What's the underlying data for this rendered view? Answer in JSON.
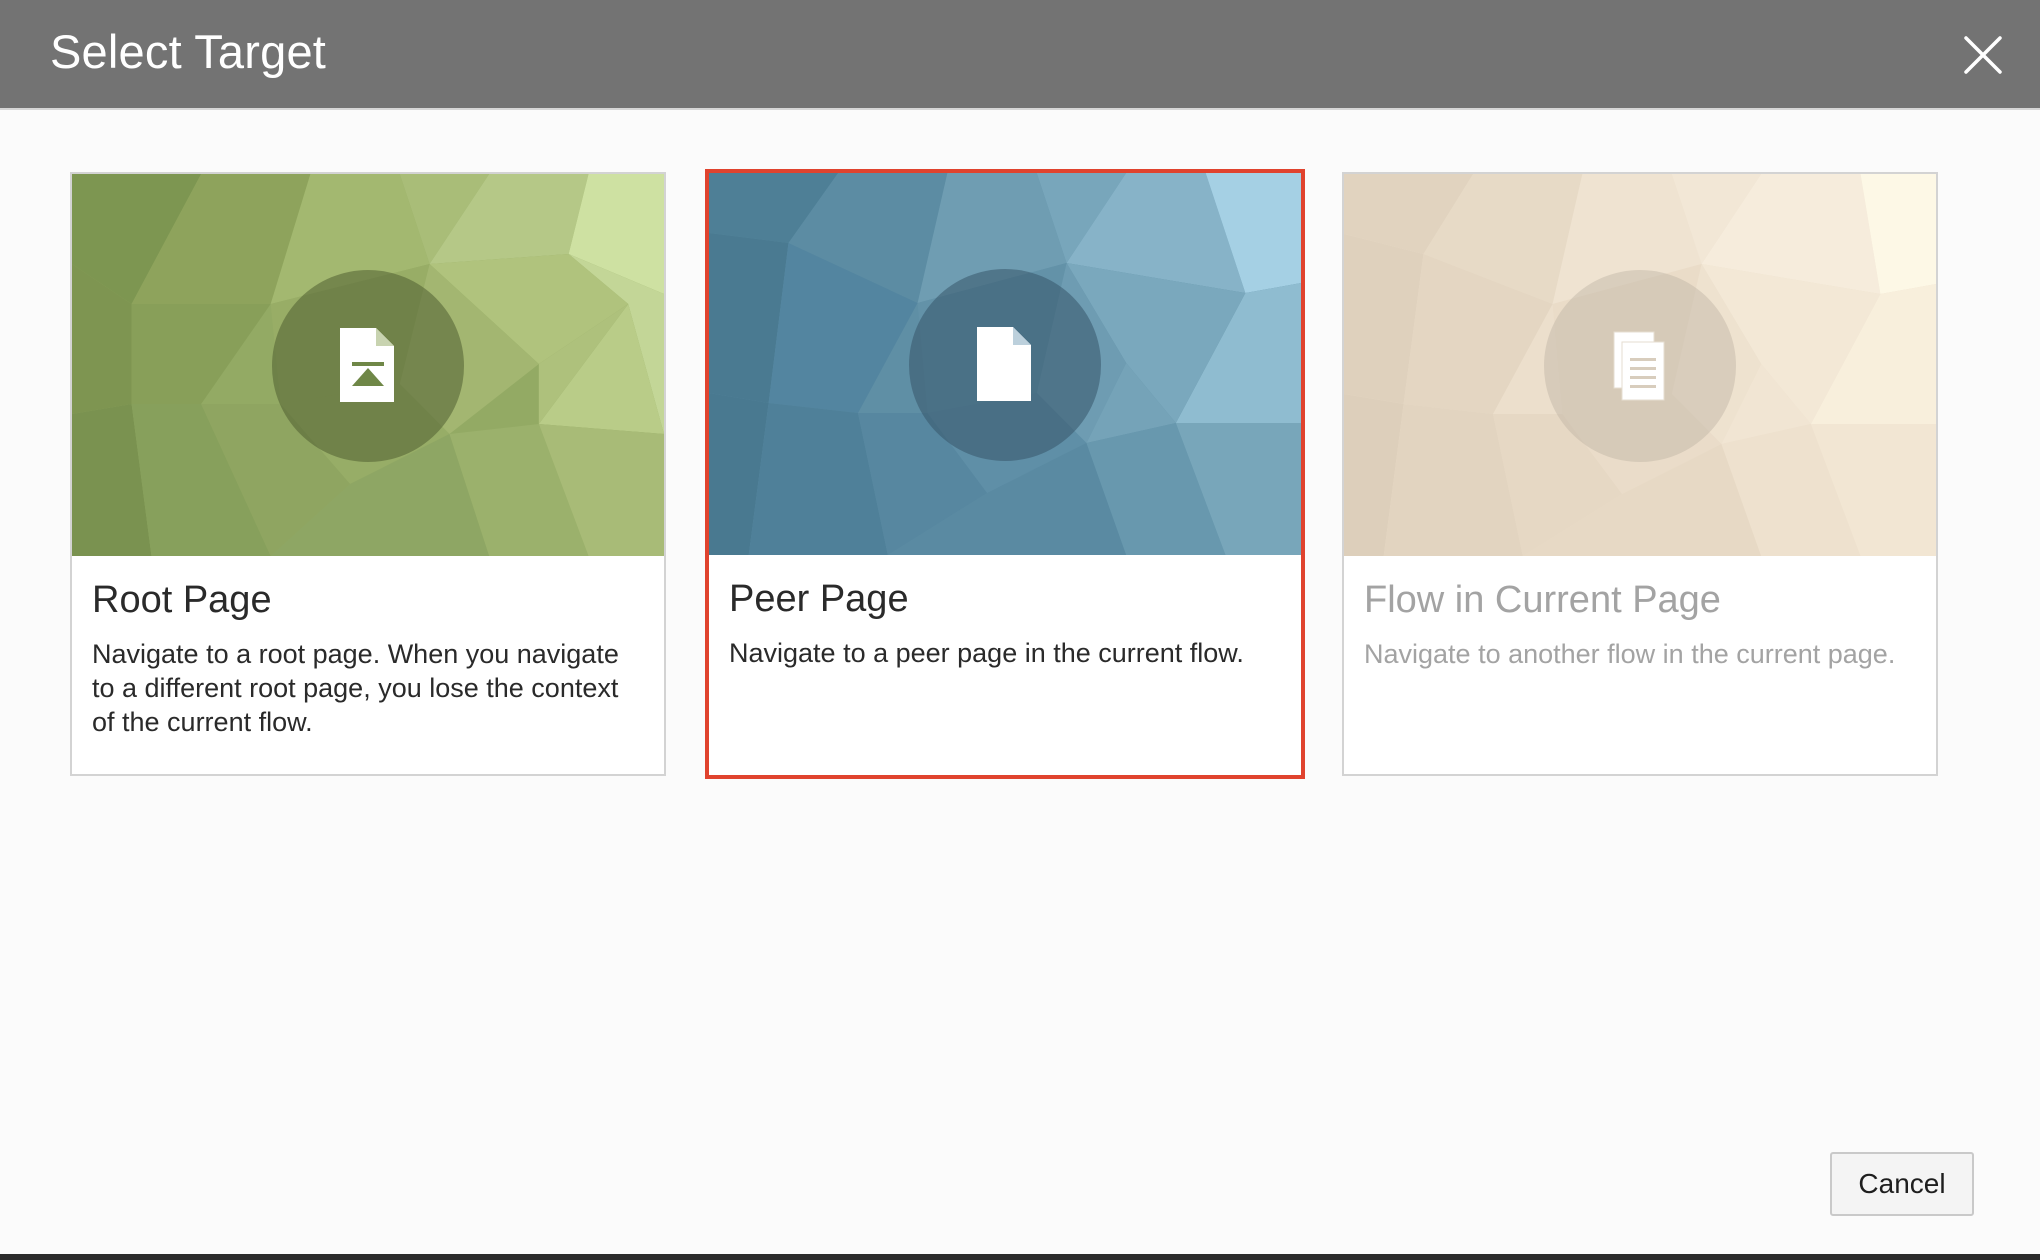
{
  "dialog": {
    "title": "Select Target",
    "close_icon": "close-icon"
  },
  "cards": [
    {
      "title": "Root Page",
      "description": "Navigate to a root page. When you navigate to a different root page, you lose the context of the current flow.",
      "icon": "root-page-icon",
      "theme_color": "#8aa05e",
      "selected": false,
      "disabled": false
    },
    {
      "title": "Peer Page",
      "description": "Navigate to a peer page in the current flow.",
      "icon": "peer-page-icon",
      "theme_color": "#5a8ca3",
      "selected": true,
      "disabled": false
    },
    {
      "title": "Flow in Current Page",
      "description": "Navigate to another flow in the current page.",
      "icon": "flow-pages-icon",
      "theme_color": "#ead9c3",
      "selected": false,
      "disabled": true
    }
  ],
  "footer": {
    "cancel_label": "Cancel"
  },
  "colors": {
    "header_bg": "#737373",
    "selected_border": "#e0432e"
  }
}
